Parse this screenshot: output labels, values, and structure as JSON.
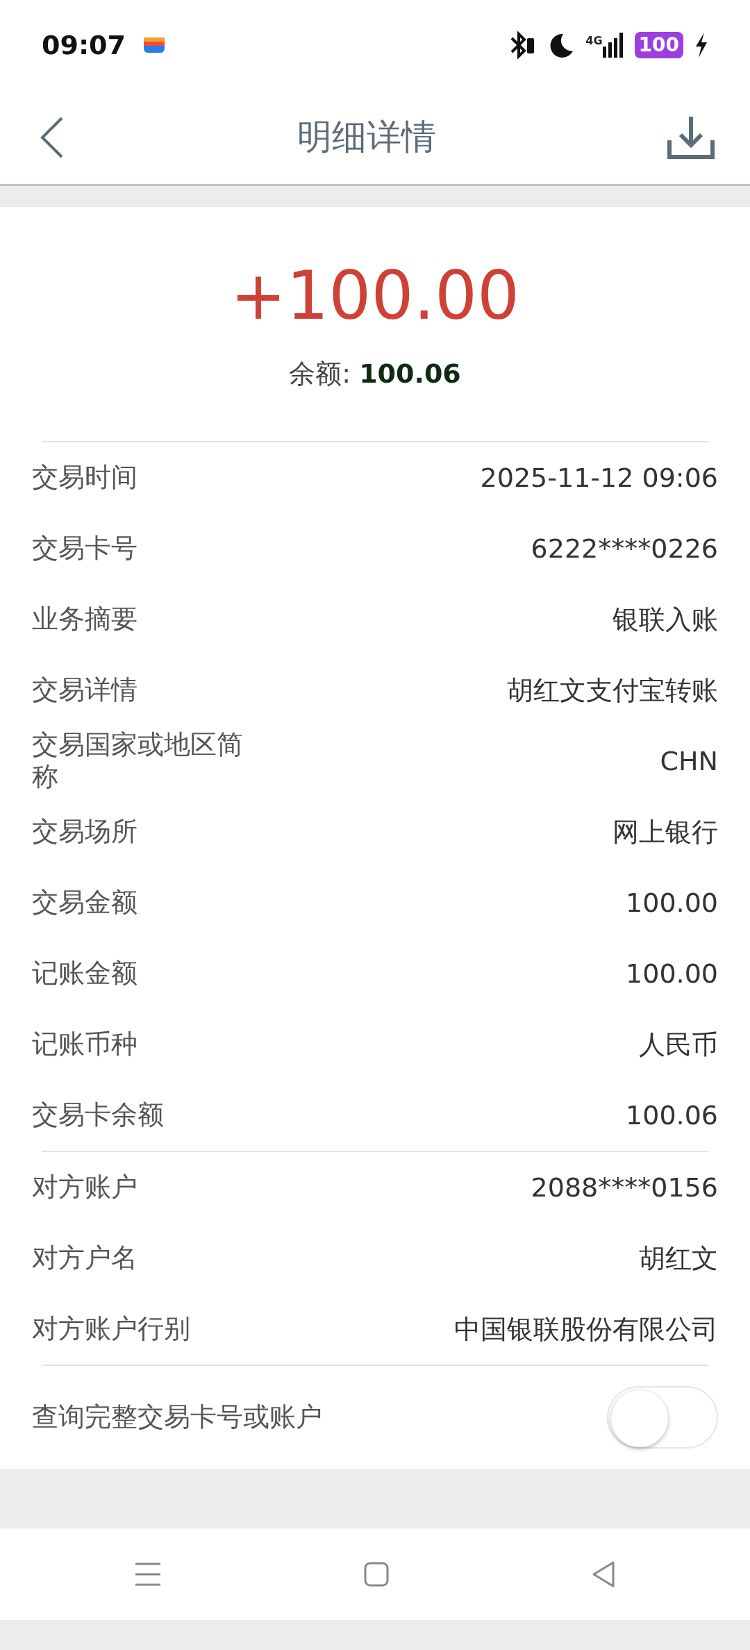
{
  "status_bar": {
    "time": "09:07",
    "network": "4G",
    "battery": "100"
  },
  "header": {
    "title": "明细详情"
  },
  "amount": "+100.00",
  "balance": {
    "label": "余额:",
    "value": "100.06"
  },
  "sections": [
    {
      "rows": [
        {
          "label": "交易时间",
          "value": "2025-11-12 09:06"
        },
        {
          "label": "交易卡号",
          "value": "6222****0226"
        },
        {
          "label": "业务摘要",
          "value": "银联入账"
        },
        {
          "label": "交易详情",
          "value": "胡红文支付宝转账"
        },
        {
          "label": "交易国家或地区简称",
          "value": "CHN"
        },
        {
          "label": "交易场所",
          "value": "网上银行"
        },
        {
          "label": "交易金额",
          "value": "100.00"
        },
        {
          "label": "记账金额",
          "value": "100.00"
        },
        {
          "label": "记账币种",
          "value": "人民币"
        },
        {
          "label": "交易卡余额",
          "value": "100.06"
        }
      ]
    },
    {
      "rows": [
        {
          "label": "对方账户",
          "value": "2088****0156"
        },
        {
          "label": "对方户名",
          "value": "胡红文"
        },
        {
          "label": "对方账户行别",
          "value": "中国银联股份有限公司"
        }
      ]
    }
  ],
  "toggle": {
    "label": "查询完整交易卡号或账户",
    "on": false
  }
}
